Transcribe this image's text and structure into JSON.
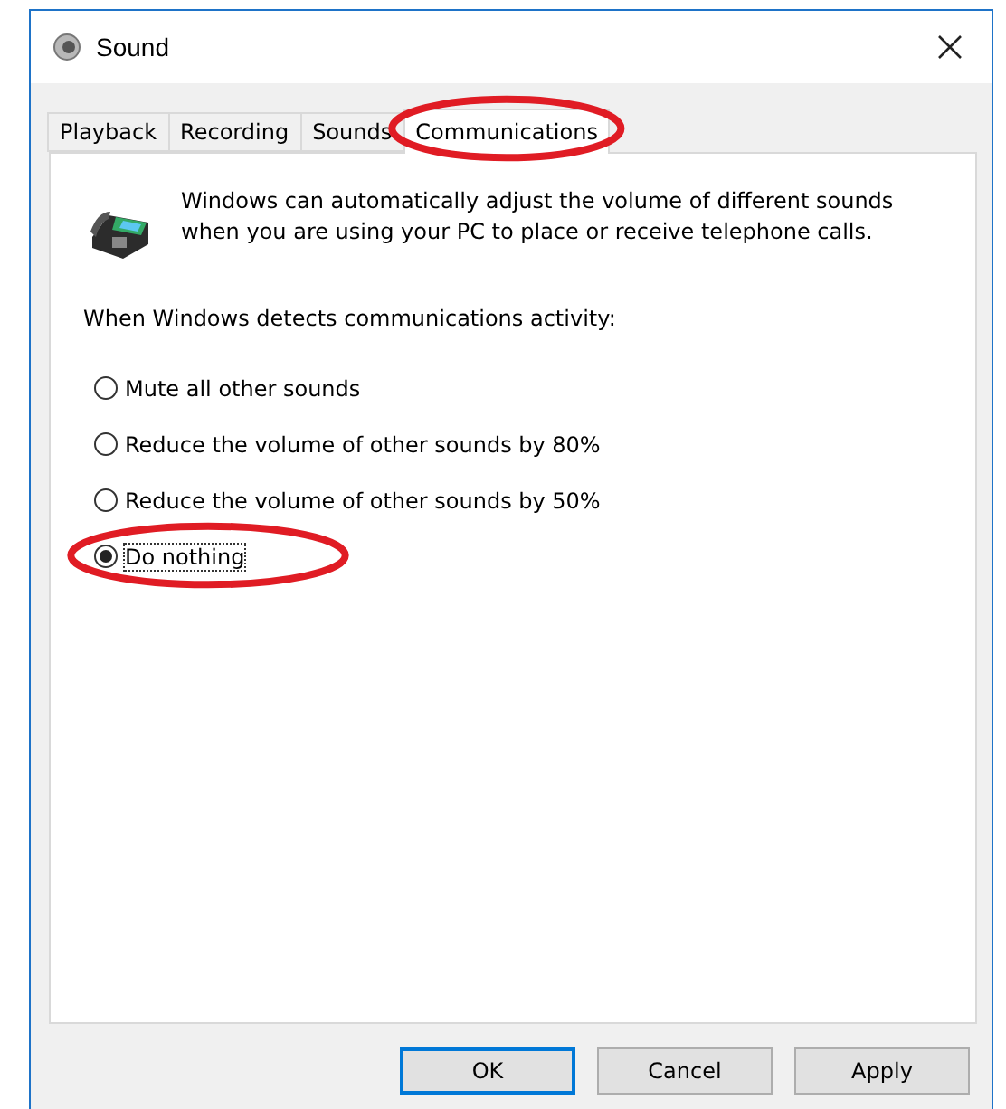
{
  "window": {
    "title": "Sound"
  },
  "tabs": [
    {
      "label": "Playback",
      "selected": false,
      "highlighted": false
    },
    {
      "label": "Recording",
      "selected": false,
      "highlighted": false
    },
    {
      "label": "Sounds",
      "selected": false,
      "highlighted": false
    },
    {
      "label": "Communications",
      "selected": true,
      "highlighted": true
    }
  ],
  "description": "Windows can automatically adjust the volume of different sounds when you are using your PC to place or receive telephone calls.",
  "prompt": "When Windows detects communications activity:",
  "options": [
    {
      "label": "Mute all other sounds",
      "selected": false,
      "highlighted": false
    },
    {
      "label": "Reduce the volume of other sounds by 80%",
      "selected": false,
      "highlighted": false
    },
    {
      "label": "Reduce the volume of other sounds by 50%",
      "selected": false,
      "highlighted": false
    },
    {
      "label": "Do nothing",
      "selected": true,
      "highlighted": true
    }
  ],
  "buttons": [
    {
      "label": "OK",
      "default": true
    },
    {
      "label": "Cancel",
      "default": false
    },
    {
      "label": "Apply",
      "default": false
    }
  ]
}
